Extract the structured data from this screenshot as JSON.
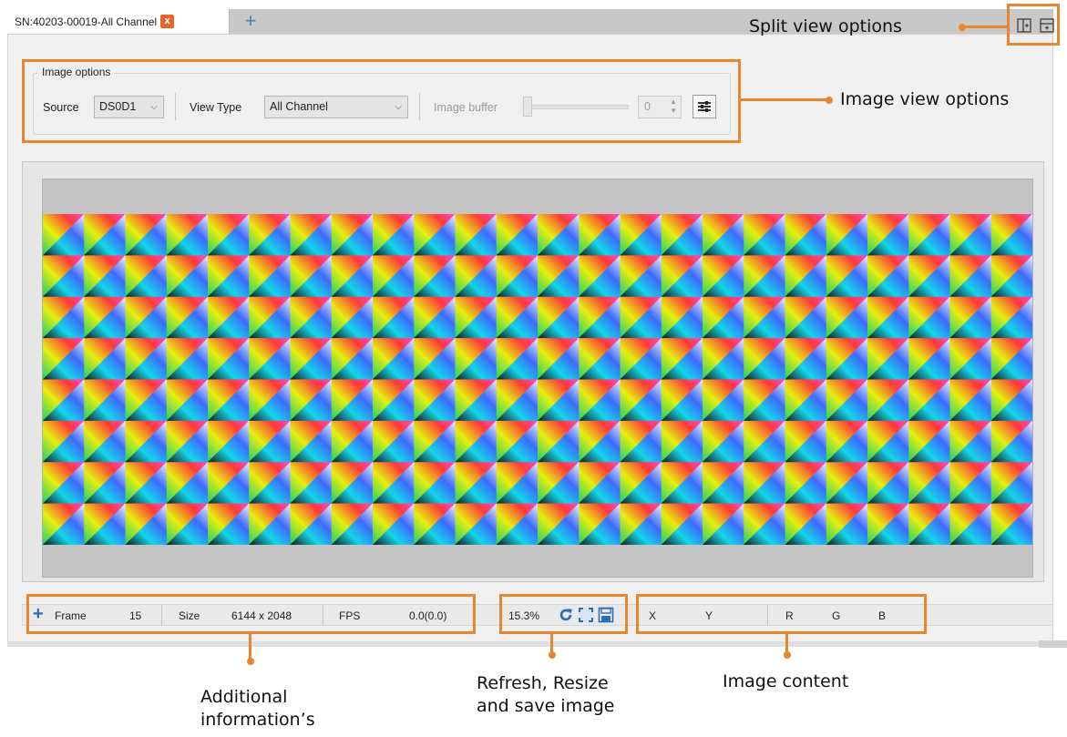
{
  "tab": {
    "title": "SN:40203-00019-All Channel",
    "close_glyph": "x",
    "add_glyph": "+"
  },
  "image_options": {
    "legend": "Image options",
    "source_label": "Source",
    "source_value": "DS0D1",
    "view_type_label": "View Type",
    "view_type_value": "All Channel",
    "image_buffer_label": "Image buffer",
    "image_buffer_value": "0",
    "image_buffer_level": 0
  },
  "status": {
    "frame_label": "Frame",
    "frame_value": "15",
    "size_label": "Size",
    "size_value": "6144 x 2048",
    "fps_label": "FPS",
    "fps_value": "0.0(0.0)",
    "zoom_value": "15.3%",
    "x_label": "X",
    "y_label": "Y",
    "r_label": "R",
    "g_label": "G",
    "b_label": "B"
  },
  "annotations": {
    "split_view": "Split view options",
    "image_view": "Image view options",
    "additional_info_1": "Additional",
    "additional_info_2": "information’s",
    "refresh_1": "Refresh, Resize",
    "refresh_2": "and save image",
    "image_content": "Image content"
  },
  "icons": {
    "split_vertical": "split-vertical-icon",
    "split_horizontal": "split-horizontal-icon",
    "tune": "tune-sliders-icon",
    "refresh": "refresh-icon",
    "resize": "fit-to-window-icon",
    "save": "save-icon",
    "add_frame": "plus-icon"
  },
  "colors": {
    "accent": "#e8852f",
    "tab_close": "#e8632e",
    "icon_blue": "#2d6db3"
  }
}
